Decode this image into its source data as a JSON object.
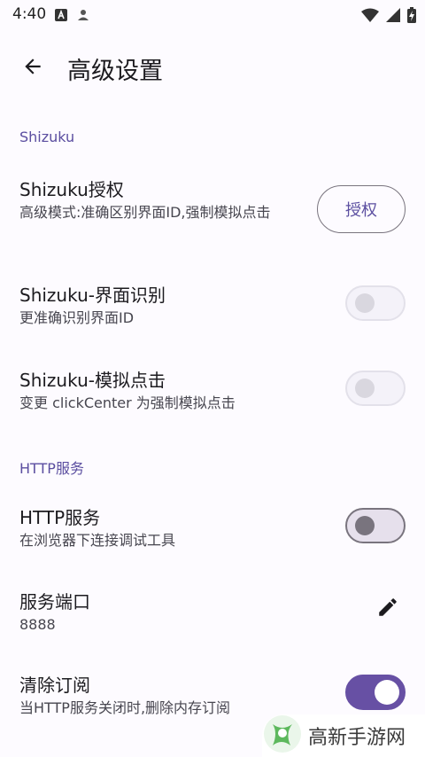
{
  "status_bar": {
    "time": "4:40",
    "icons_left": [
      "a-notification-icon",
      "person-notification-icon"
    ],
    "icons_right": [
      "wifi-icon",
      "signal-icon",
      "battery-charging-icon"
    ]
  },
  "app_bar": {
    "back_icon": "arrow-back-icon",
    "title": "高级设置"
  },
  "sections": {
    "shizuku": {
      "header": "Shizuku",
      "auth": {
        "title": "Shizuku授权",
        "subtitle": "高级模式:准确区别界面ID,强制模拟点击",
        "button_label": "授权"
      },
      "ui_recognition": {
        "title": "Shizuku-界面识别",
        "subtitle": "更准确识别界面ID",
        "enabled": false
      },
      "simulate_click": {
        "title": "Shizuku-模拟点击",
        "subtitle": "变更 clickCenter 为强制模拟点击",
        "enabled": false
      }
    },
    "http": {
      "header": "HTTP服务",
      "service": {
        "title": "HTTP服务",
        "subtitle": "在浏览器下连接调试工具",
        "enabled": false
      },
      "port": {
        "title": "服务端口",
        "value": "8888",
        "edit_icon": "pencil-icon"
      },
      "clear_subscriptions": {
        "title": "清除订阅",
        "subtitle": "当HTTP服务关闭时,删除内存订阅",
        "enabled": true
      }
    }
  },
  "watermark": {
    "text": "高新手游网"
  },
  "colors": {
    "accent": "#6750a4",
    "section_header": "#5b4ea0",
    "background": "#fdfbff",
    "switch_off_outline": "#79747e"
  }
}
